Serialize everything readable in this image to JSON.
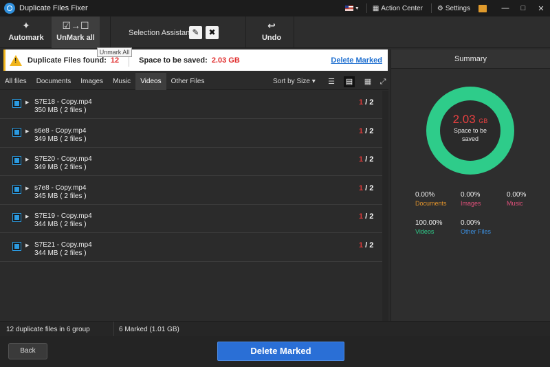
{
  "window": {
    "title": "Duplicate Files Fixer",
    "action_center": "Action Center",
    "settings": "Settings",
    "minimize": "—",
    "maximize": "□",
    "close": "✕"
  },
  "toolbar": {
    "automark": "Automark",
    "unmark_all": "UnMark all",
    "selection_assistant": "Selection Assistant",
    "undo": "Undo",
    "tooltip": "Unmark All"
  },
  "infobar": {
    "duplicates_label": "Duplicate Files found:",
    "duplicates_value": "12",
    "space_label": "Space to be saved:",
    "space_value": "2.03 GB",
    "delete_link": "Delete Marked"
  },
  "tabs": [
    "All files",
    "Documents",
    "Images",
    "Music",
    "Videos",
    "Other Files"
  ],
  "active_tab": "Videos",
  "sort_label": "Sort by Size",
  "files": [
    {
      "name": "S7E18 - Copy.mp4",
      "meta": "350 MB  ( 2 files )",
      "marked": "1",
      "total": "2"
    },
    {
      "name": "s6e8 - Copy.mp4",
      "meta": "349 MB  ( 2 files )",
      "marked": "1",
      "total": "2"
    },
    {
      "name": "S7E20 - Copy.mp4",
      "meta": "349 MB  ( 2 files )",
      "marked": "1",
      "total": "2"
    },
    {
      "name": "s7e8 - Copy.mp4",
      "meta": "345 MB  ( 2 files )",
      "marked": "1",
      "total": "2"
    },
    {
      "name": "S7E19 - Copy.mp4",
      "meta": "344 MB  ( 2 files )",
      "marked": "1",
      "total": "2"
    },
    {
      "name": "S7E21 - Copy.mp4",
      "meta": "344 MB  ( 2 files )",
      "marked": "1",
      "total": "2"
    }
  ],
  "summary": {
    "title": "Summary",
    "ring_value": "2.03",
    "ring_unit": "GB",
    "ring_label_1": "Space to be",
    "ring_label_2": "saved",
    "stats": [
      {
        "value": "0.00%",
        "name": "Documents",
        "color": "#e0932c"
      },
      {
        "value": "0.00%",
        "name": "Images",
        "color": "#e0507a"
      },
      {
        "value": "0.00%",
        "name": "Music",
        "color": "#e0507a"
      },
      {
        "value": "100.00%",
        "name": "Videos",
        "color": "#2ecc8a"
      },
      {
        "value": "0.00%",
        "name": "Other Files",
        "color": "#3b8fe0"
      }
    ]
  },
  "status": {
    "groups": "12 duplicate files in 6 group",
    "marked": "6 Marked (1.01 GB)"
  },
  "footer": {
    "back": "Back",
    "delete_marked": "Delete Marked"
  },
  "colors": {
    "accent_blue": "#2a6fd6",
    "ring_green": "#2ecc8a",
    "alert_red": "#e02b2b",
    "warning_yellow": "#f1b51c"
  }
}
